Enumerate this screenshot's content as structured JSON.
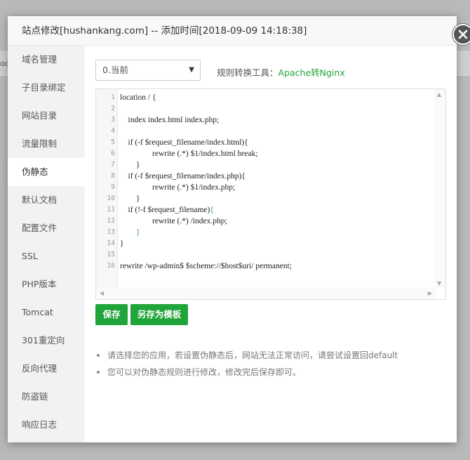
{
  "background": {
    "fragment": "oo"
  },
  "dialog": {
    "title": "站点修改[hushankang.com] -- 添加时间[2018-09-09 14:18:38]"
  },
  "sidebar": {
    "items": [
      {
        "label": "域名管理",
        "active": false
      },
      {
        "label": "子目录绑定",
        "active": false
      },
      {
        "label": "网站目录",
        "active": false
      },
      {
        "label": "流量限制",
        "active": false
      },
      {
        "label": "伪静态",
        "active": true
      },
      {
        "label": "默认文档",
        "active": false
      },
      {
        "label": "配置文件",
        "active": false
      },
      {
        "label": "SSL",
        "active": false
      },
      {
        "label": "PHP版本",
        "active": false
      },
      {
        "label": "Tomcat",
        "active": false
      },
      {
        "label": "301重定向",
        "active": false
      },
      {
        "label": "反向代理",
        "active": false
      },
      {
        "label": "防盗链",
        "active": false
      },
      {
        "label": "响应日志",
        "active": false
      }
    ]
  },
  "rewrite": {
    "select_value": "0.当前",
    "tool_label": "规则转换工具：",
    "tool_link": "Apache转Nginx"
  },
  "editor": {
    "lines": [
      "location / {",
      "",
      "    index index.html index.php;",
      "",
      "    if (-f $request_filename/index.html){",
      "                rewrite (.*) $1/index.html break;",
      "        }",
      "    if (-f $request_filename/index.php){",
      "                rewrite (.*) $1/index.php;",
      "        }",
      "    if (!-f $request_filename){",
      "                rewrite (.*) /index.php;",
      "        }",
      "}",
      "",
      "rewrite /wp-admin$ $scheme://$host$uri/ permanent;"
    ]
  },
  "buttons": {
    "save": "保存",
    "save_as_template": "另存为模板"
  },
  "tips": [
    "请选择您的应用，若设置伪静态后，网站无法正常访问，请尝试设置回default",
    "您可以对伪静态规则进行修改，修改完后保存即可。"
  ],
  "colors": {
    "accent": "#20a53a",
    "overlay": "#8f8f8f",
    "close_button": "#555555"
  },
  "icons": {
    "close": "close-icon",
    "select_caret": "caret-down-icon",
    "scroll_up": "scroll-up-icon",
    "scroll_down": "scroll-down-icon",
    "scroll_left": "scroll-left-icon",
    "scroll_right": "scroll-right-icon"
  }
}
